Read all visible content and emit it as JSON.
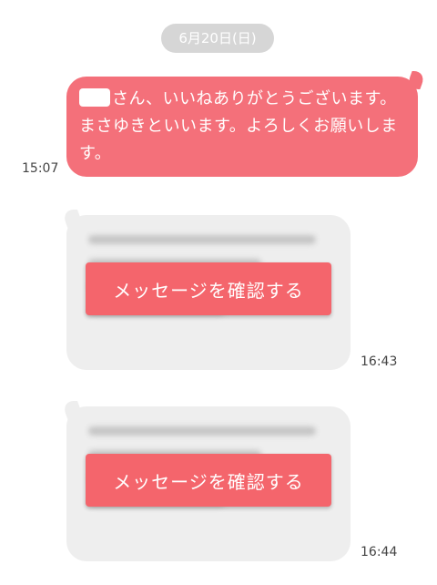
{
  "date_separator": "6月20日(日)",
  "messages": [
    {
      "direction": "sent",
      "text": "さん、いいねありがとうございます。まさゆきといいます。よろしくお願いします。",
      "time": "15:07"
    },
    {
      "direction": "received",
      "button_label": "メッセージを確認する",
      "time": "16:43"
    },
    {
      "direction": "received",
      "button_label": "メッセージを確認する",
      "time": "16:44"
    }
  ],
  "colors": {
    "sent_bubble": "#f4707a",
    "received_bubble": "#eeeeee",
    "button": "#f4656c",
    "date_pill": "#d6d6d6"
  }
}
